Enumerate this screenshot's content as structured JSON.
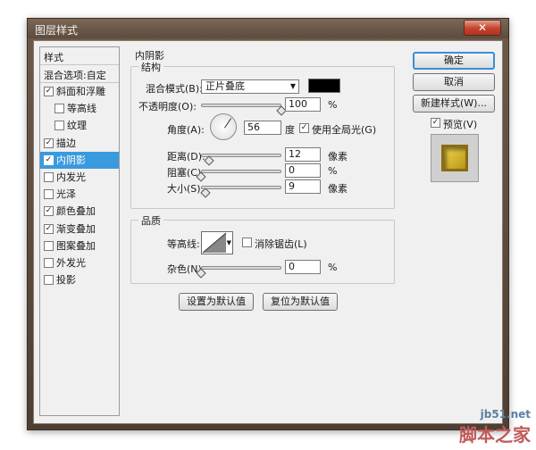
{
  "window": {
    "title": "图层样式",
    "close_glyph": "✕"
  },
  "style_list": {
    "header": "样式",
    "blend_options": "混合选项:自定",
    "items": [
      {
        "label": "斜面和浮雕",
        "checked": true,
        "sub": false,
        "selected": false
      },
      {
        "label": "等高线",
        "checked": false,
        "sub": true,
        "selected": false
      },
      {
        "label": "纹理",
        "checked": false,
        "sub": true,
        "selected": false
      },
      {
        "label": "描边",
        "checked": true,
        "sub": false,
        "selected": false
      },
      {
        "label": "内阴影",
        "checked": true,
        "sub": false,
        "selected": true
      },
      {
        "label": "内发光",
        "checked": false,
        "sub": false,
        "selected": false
      },
      {
        "label": "光泽",
        "checked": false,
        "sub": false,
        "selected": false
      },
      {
        "label": "颜色叠加",
        "checked": true,
        "sub": false,
        "selected": false
      },
      {
        "label": "渐变叠加",
        "checked": true,
        "sub": false,
        "selected": false
      },
      {
        "label": "图案叠加",
        "checked": false,
        "sub": false,
        "selected": false
      },
      {
        "label": "外发光",
        "checked": false,
        "sub": false,
        "selected": false
      },
      {
        "label": "投影",
        "checked": false,
        "sub": false,
        "selected": false
      }
    ]
  },
  "inner_shadow": {
    "title": "内阴影",
    "structure": {
      "legend": "结构",
      "blend_mode_label": "混合模式(B):",
      "blend_mode_value": "正片叠底",
      "shadow_color": "#000000",
      "opacity_label": "不透明度(O):",
      "opacity_value": "100",
      "opacity_level": 1.0,
      "opacity_unit": "%",
      "angle_label": "角度(A):",
      "angle_value": "56",
      "angle_unit": "度",
      "global_light_label": "使用全局光(G)",
      "global_light_checked": true,
      "distance_label": "距离(D):",
      "distance_value": "12",
      "distance_level": 0.1,
      "distance_unit": "像素",
      "choke_label": "阻塞(C):",
      "choke_value": "0",
      "choke_level": 0.0,
      "choke_unit": "%",
      "size_label": "大小(S):",
      "size_value": "9",
      "size_level": 0.05,
      "size_unit": "像素"
    },
    "quality": {
      "legend": "品质",
      "contour_label": "等高线:",
      "antialias_label": "消除锯齿(L)",
      "antialias_checked": false,
      "noise_label": "杂色(N):",
      "noise_value": "0",
      "noise_level": 0.0,
      "noise_unit": "%"
    },
    "make_default": "设置为默认值",
    "reset_default": "复位为默认值"
  },
  "buttons": {
    "ok": "确定",
    "cancel": "取消",
    "new_style": "新建样式(W)...",
    "preview_label": "预览(V)",
    "preview_checked": true
  },
  "watermark": {
    "url": "jb51.net",
    "name": "脚本之家"
  }
}
